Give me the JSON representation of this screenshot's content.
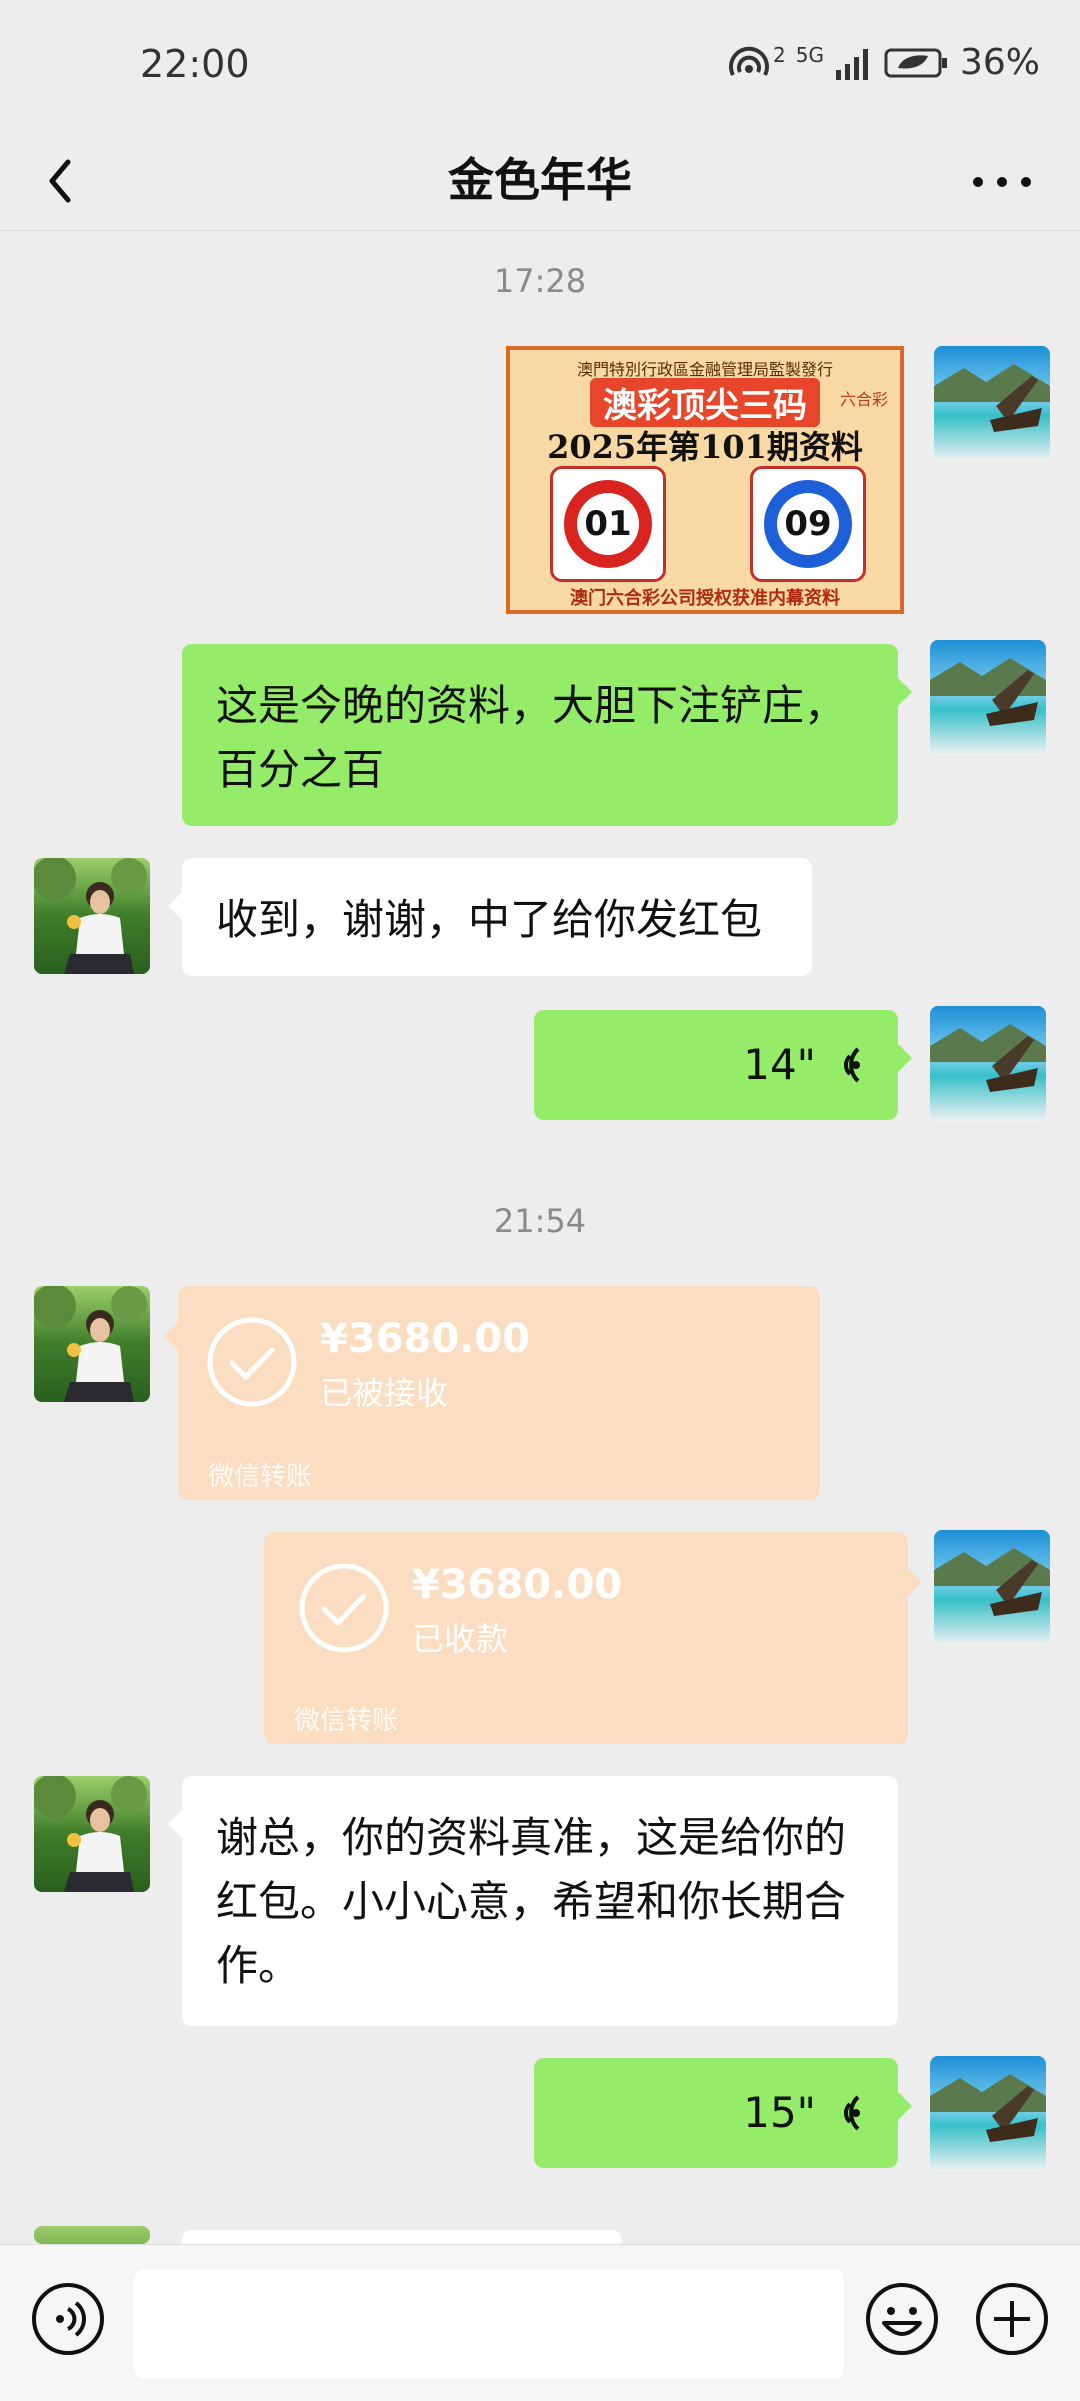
{
  "status_bar": {
    "time": "22:00",
    "battery": "36%",
    "network": "5G",
    "sim_index": "2"
  },
  "header": {
    "title": "金色年华"
  },
  "timestamps": [
    "17:28",
    "21:54"
  ],
  "lottery_image": {
    "line1": "澳門特別行政區金融管理局監製發行",
    "brand": "澳彩顶尖三码",
    "badge": "六合彩",
    "title": "2025年第101期资料",
    "balls": [
      "01",
      "09"
    ],
    "footer": "澳门六合彩公司授权获准内幕资料"
  },
  "messages": {
    "m1": "这是今晚的资料，大胆下注铲庄，百分之百",
    "m2": "收到，谢谢，中了给你发红包",
    "voice1": "14\"",
    "transfer1": {
      "amount": "¥3680.00",
      "status": "已被接收",
      "label": "微信转账"
    },
    "transfer2": {
      "amount": "¥3680.00",
      "status": "已收款",
      "label": "微信转账"
    },
    "m3": "谢总，你的资料真准，这是给你的红包。小小心意，希望和你长期合作。",
    "voice2": "15\""
  },
  "composer": {
    "placeholder": ""
  },
  "colors": {
    "self_bubble": "#95ec69",
    "other_bubble": "#ffffff",
    "transfer": "#fbdec1",
    "background": "#ededed"
  }
}
